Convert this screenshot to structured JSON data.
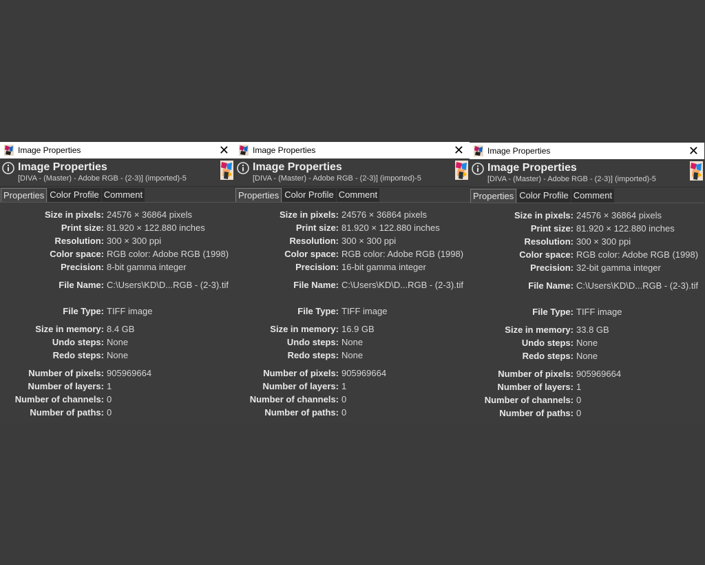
{
  "colors": {
    "background": "#3b3b3b",
    "panel": "#3c3c3c",
    "titlebar": "#ffffff",
    "text": "#dcdcdc"
  },
  "dialogs": [
    {
      "window_title": "Image Properties",
      "header_title": "Image Properties",
      "header_subtitle": "[DIVA - (Master) - Adobe RGB - (2-3)] (imported)-5",
      "tabs": [
        "Properties",
        "Color Profile",
        "Comment"
      ],
      "active_tab": "Properties",
      "properties": {
        "size_in_pixels": {
          "label": "Size in pixels:",
          "value": "24576 × 36864 pixels"
        },
        "print_size": {
          "label": "Print size:",
          "value": "81.920 × 122.880 inches"
        },
        "resolution": {
          "label": "Resolution:",
          "value": "300 × 300 ppi"
        },
        "color_space": {
          "label": "Color space:",
          "value": "RGB color: Adobe RGB (1998)"
        },
        "precision": {
          "label": "Precision:",
          "value": "8-bit gamma integer"
        },
        "file_name": {
          "label": "File Name:",
          "value": "C:\\Users\\KD\\D...RGB - (2-3).tif"
        },
        "file_type": {
          "label": "File Type:",
          "value": "TIFF image"
        },
        "size_in_memory": {
          "label": "Size in memory:",
          "value": "8.4 GB"
        },
        "undo_steps": {
          "label": "Undo steps:",
          "value": "None"
        },
        "redo_steps": {
          "label": "Redo steps:",
          "value": "None"
        },
        "number_of_pixels": {
          "label": "Number of pixels:",
          "value": "905969664"
        },
        "number_of_layers": {
          "label": "Number of layers:",
          "value": "1"
        },
        "number_of_channels": {
          "label": "Number of channels:",
          "value": "0"
        },
        "number_of_paths": {
          "label": "Number of paths:",
          "value": "0"
        }
      }
    },
    {
      "window_title": "Image Properties",
      "header_title": "Image Properties",
      "header_subtitle": "[DIVA - (Master) - Adobe RGB - (2-3)] (imported)-5",
      "tabs": [
        "Properties",
        "Color Profile",
        "Comment"
      ],
      "active_tab": "Properties",
      "properties": {
        "size_in_pixels": {
          "label": "Size in pixels:",
          "value": "24576 × 36864 pixels"
        },
        "print_size": {
          "label": "Print size:",
          "value": "81.920 × 122.880 inches"
        },
        "resolution": {
          "label": "Resolution:",
          "value": "300 × 300 ppi"
        },
        "color_space": {
          "label": "Color space:",
          "value": "RGB color: Adobe RGB (1998)"
        },
        "precision": {
          "label": "Precision:",
          "value": "16-bit gamma integer"
        },
        "file_name": {
          "label": "File Name:",
          "value": "C:\\Users\\KD\\D...RGB - (2-3).tif"
        },
        "file_type": {
          "label": "File Type:",
          "value": "TIFF image"
        },
        "size_in_memory": {
          "label": "Size in memory:",
          "value": "16.9 GB"
        },
        "undo_steps": {
          "label": "Undo steps:",
          "value": "None"
        },
        "redo_steps": {
          "label": "Redo steps:",
          "value": "None"
        },
        "number_of_pixels": {
          "label": "Number of pixels:",
          "value": "905969664"
        },
        "number_of_layers": {
          "label": "Number of layers:",
          "value": "1"
        },
        "number_of_channels": {
          "label": "Number of channels:",
          "value": "0"
        },
        "number_of_paths": {
          "label": "Number of paths:",
          "value": "0"
        }
      }
    },
    {
      "window_title": "Image Properties",
      "header_title": "Image Properties",
      "header_subtitle": "[DIVA - (Master) - Adobe RGB - (2-3)] (imported)-5",
      "tabs": [
        "Properties",
        "Color Profile",
        "Comment"
      ],
      "active_tab": "Properties",
      "properties": {
        "size_in_pixels": {
          "label": "Size in pixels:",
          "value": "24576 × 36864 pixels"
        },
        "print_size": {
          "label": "Print size:",
          "value": "81.920 × 122.880 inches"
        },
        "resolution": {
          "label": "Resolution:",
          "value": "300 × 300 ppi"
        },
        "color_space": {
          "label": "Color space:",
          "value": "RGB color: Adobe RGB (1998)"
        },
        "precision": {
          "label": "Precision:",
          "value": "32-bit gamma integer"
        },
        "file_name": {
          "label": "File Name:",
          "value": "C:\\Users\\KD\\D...RGB - (2-3).tif"
        },
        "file_type": {
          "label": "File Type:",
          "value": "TIFF image"
        },
        "size_in_memory": {
          "label": "Size in memory:",
          "value": "33.8 GB"
        },
        "undo_steps": {
          "label": "Undo steps:",
          "value": "None"
        },
        "redo_steps": {
          "label": "Redo steps:",
          "value": "None"
        },
        "number_of_pixels": {
          "label": "Number of pixels:",
          "value": "905969664"
        },
        "number_of_layers": {
          "label": "Number of layers:",
          "value": "1"
        },
        "number_of_channels": {
          "label": "Number of channels:",
          "value": "0"
        },
        "number_of_paths": {
          "label": "Number of paths:",
          "value": "0"
        }
      }
    }
  ]
}
